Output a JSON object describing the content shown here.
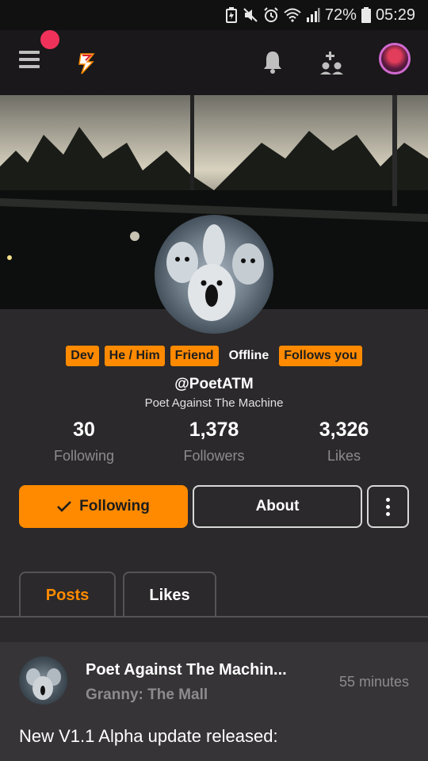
{
  "status_bar": {
    "battery_percent": "72%",
    "time": "05:29",
    "icons": [
      "battery-saver-icon",
      "mute-icon",
      "alarm-icon",
      "wifi-icon",
      "signal-icon",
      "battery-icon"
    ]
  },
  "topbar": {
    "icons": [
      "menu-icon",
      "app-logo-icon",
      "bell-icon",
      "add-friend-icon",
      "user-avatar"
    ],
    "notification_dot_color": "#f0325a"
  },
  "profile": {
    "tags": [
      {
        "label": "Dev",
        "style": "orange"
      },
      {
        "label": "He / Him",
        "style": "orange"
      },
      {
        "label": "Friend",
        "style": "orange"
      },
      {
        "label": "Offline",
        "style": "plain"
      },
      {
        "label": "Follows you",
        "style": "orange"
      }
    ],
    "username": "@PoetATM",
    "display_name": "Poet Against The Machine",
    "stats": [
      {
        "value": "30",
        "label": "Following"
      },
      {
        "value": "1,378",
        "label": "Followers"
      },
      {
        "value": "3,326",
        "label": "Likes"
      }
    ]
  },
  "actions": {
    "following_label": "Following",
    "about_label": "About",
    "more_icon": "more-vertical-icon"
  },
  "tabs": [
    {
      "label": "Posts",
      "active": true
    },
    {
      "label": "Likes",
      "active": false
    }
  ],
  "post": {
    "author": "Poet Against The Machin...",
    "community": "Granny: The Mall",
    "time": "55 minutes",
    "text": "New V1.1 Alpha update released:"
  },
  "colors": {
    "accent": "#ff8a00",
    "background": "#2b292b",
    "topbar": "#1a181a",
    "post_card": "#363436",
    "muted_text": "#8d8b8d"
  }
}
